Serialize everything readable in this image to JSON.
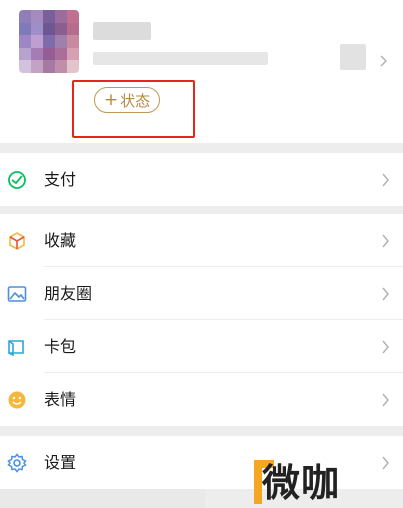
{
  "profile": {
    "status_label": "状态",
    "status_plus": "+"
  },
  "menu": {
    "pay": {
      "label": "支付",
      "icon": "wechat-pay-icon"
    },
    "favorites": {
      "label": "收藏",
      "icon": "cube-icon"
    },
    "moments": {
      "label": "朋友圈",
      "icon": "photo-icon"
    },
    "cards": {
      "label": "卡包",
      "icon": "wallet-icon"
    },
    "stickers": {
      "label": "表情",
      "icon": "smiley-icon"
    },
    "settings": {
      "label": "设置",
      "icon": "gear-icon"
    }
  },
  "watermark": {
    "text": "微咖"
  },
  "colors": {
    "background": "#ededed",
    "accent_status": "#b48a3f",
    "highlight_border": "#e8251a",
    "pay_green": "#07c160",
    "settings_blue": "#4a90e2",
    "smiley_yellow": "#f4b83c"
  }
}
